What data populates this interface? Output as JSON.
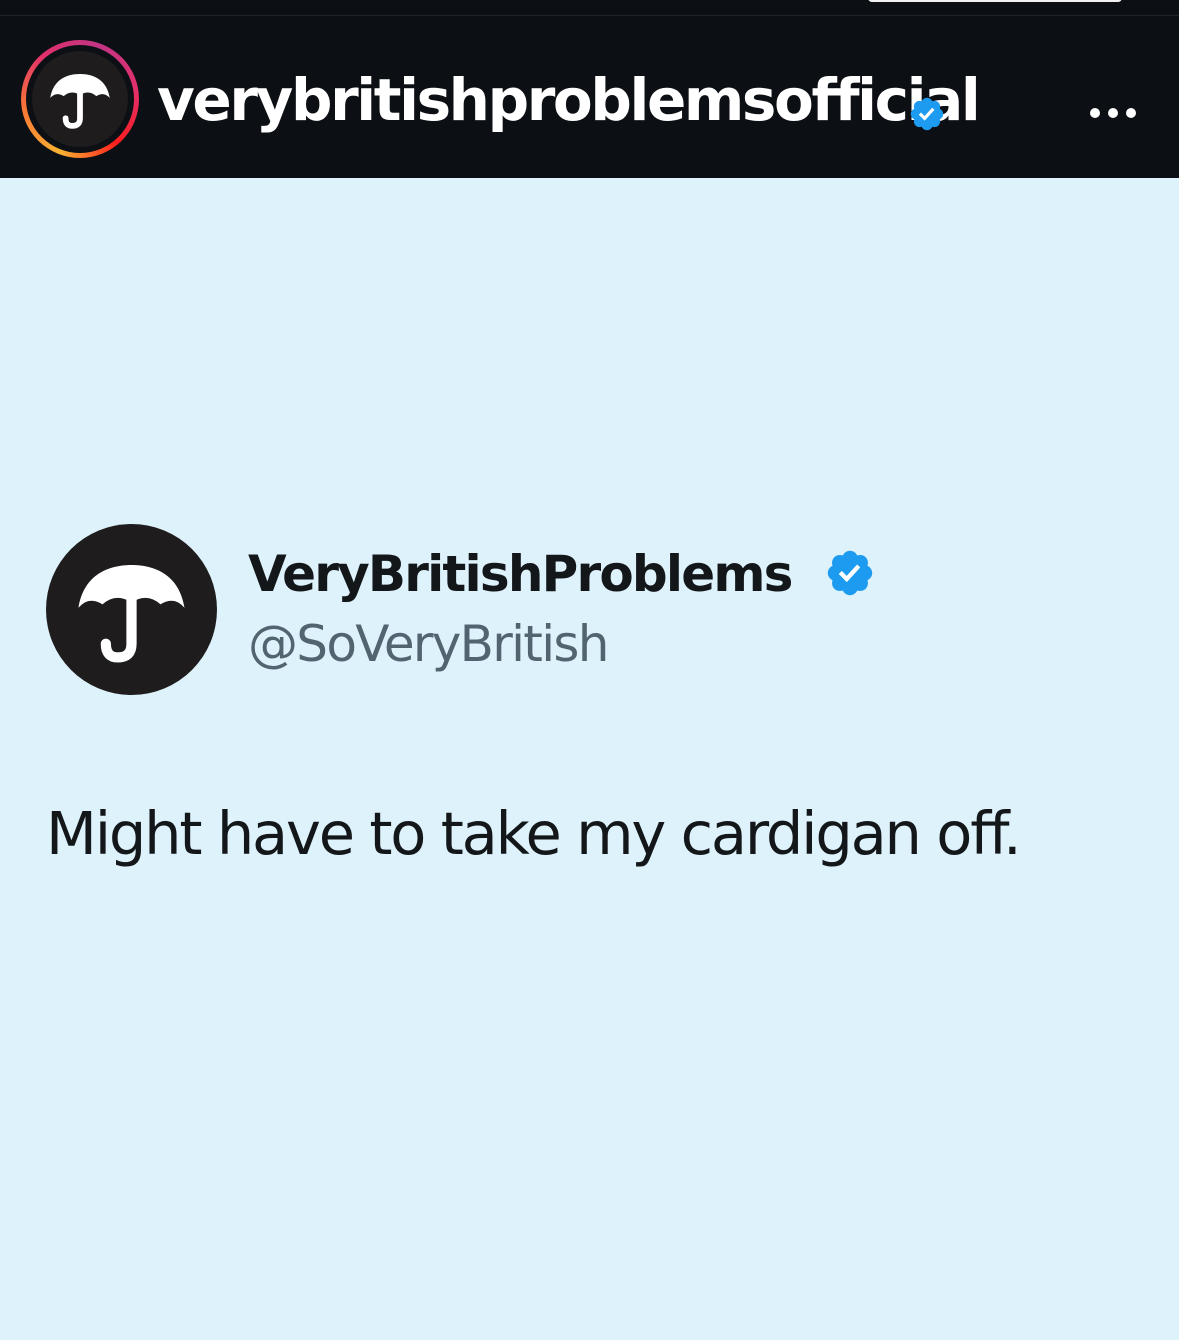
{
  "header": {
    "username": "verybritishproblemsofficial",
    "verified_icon": "verified-badge-icon",
    "avatar_icon": "umbrella-icon",
    "more_icon": "more-options-icon"
  },
  "tweet": {
    "display_name": "VeryBritishProblems",
    "handle": "@SoVeryBritish",
    "text": "Might have to take my cardigan off.",
    "avatar_icon": "umbrella-icon",
    "verified_icon": "verified-badge-icon"
  },
  "colors": {
    "header_background": "#0c0f14",
    "post_background": "#ddf2fb",
    "verified_blue": "#1d9bf0",
    "text_primary": "#14171a",
    "text_secondary": "#536471"
  }
}
